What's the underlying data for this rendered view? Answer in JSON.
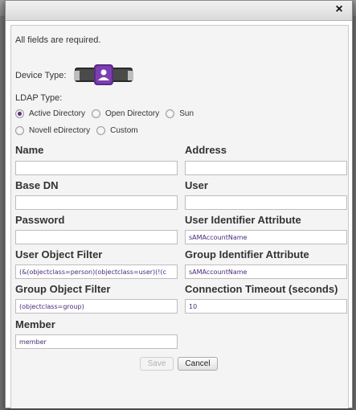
{
  "dialog": {
    "close_glyph": "×",
    "required_note": "All fields are required."
  },
  "device": {
    "label": "Device Type:",
    "icon": "server-user-icon"
  },
  "ldap": {
    "label": "LDAP Type:",
    "options": [
      "Active Directory",
      "Open Directory",
      "Sun",
      "Novell eDirectory",
      "Custom"
    ],
    "selected": "Active Directory"
  },
  "fields": {
    "name": {
      "label": "Name",
      "value": ""
    },
    "address": {
      "label": "Address",
      "value": ""
    },
    "base_dn": {
      "label": "Base DN",
      "value": ""
    },
    "user": {
      "label": "User",
      "value": ""
    },
    "password": {
      "label": "Password",
      "value": ""
    },
    "user_identifier": {
      "label": "User Identifier Attribute",
      "value": "sAMAccountName"
    },
    "user_object_filter": {
      "label": "User Object Filter",
      "value": "(&(objectclass=person)(objectclass=user)(!(c"
    },
    "group_identifier": {
      "label": "Group Identifier Attribute",
      "value": "sAMAccountName"
    },
    "group_object_filter": {
      "label": "Group Object Filter",
      "value": "(objectclass=group)"
    },
    "connection_timeout": {
      "label": "Connection Timeout (seconds)",
      "value": "10"
    },
    "member": {
      "label": "Member",
      "value": "member"
    }
  },
  "buttons": {
    "save": "Save",
    "cancel": "Cancel"
  },
  "colors": {
    "accent": "#5b2a86",
    "value_text": "#4a2a7a"
  }
}
